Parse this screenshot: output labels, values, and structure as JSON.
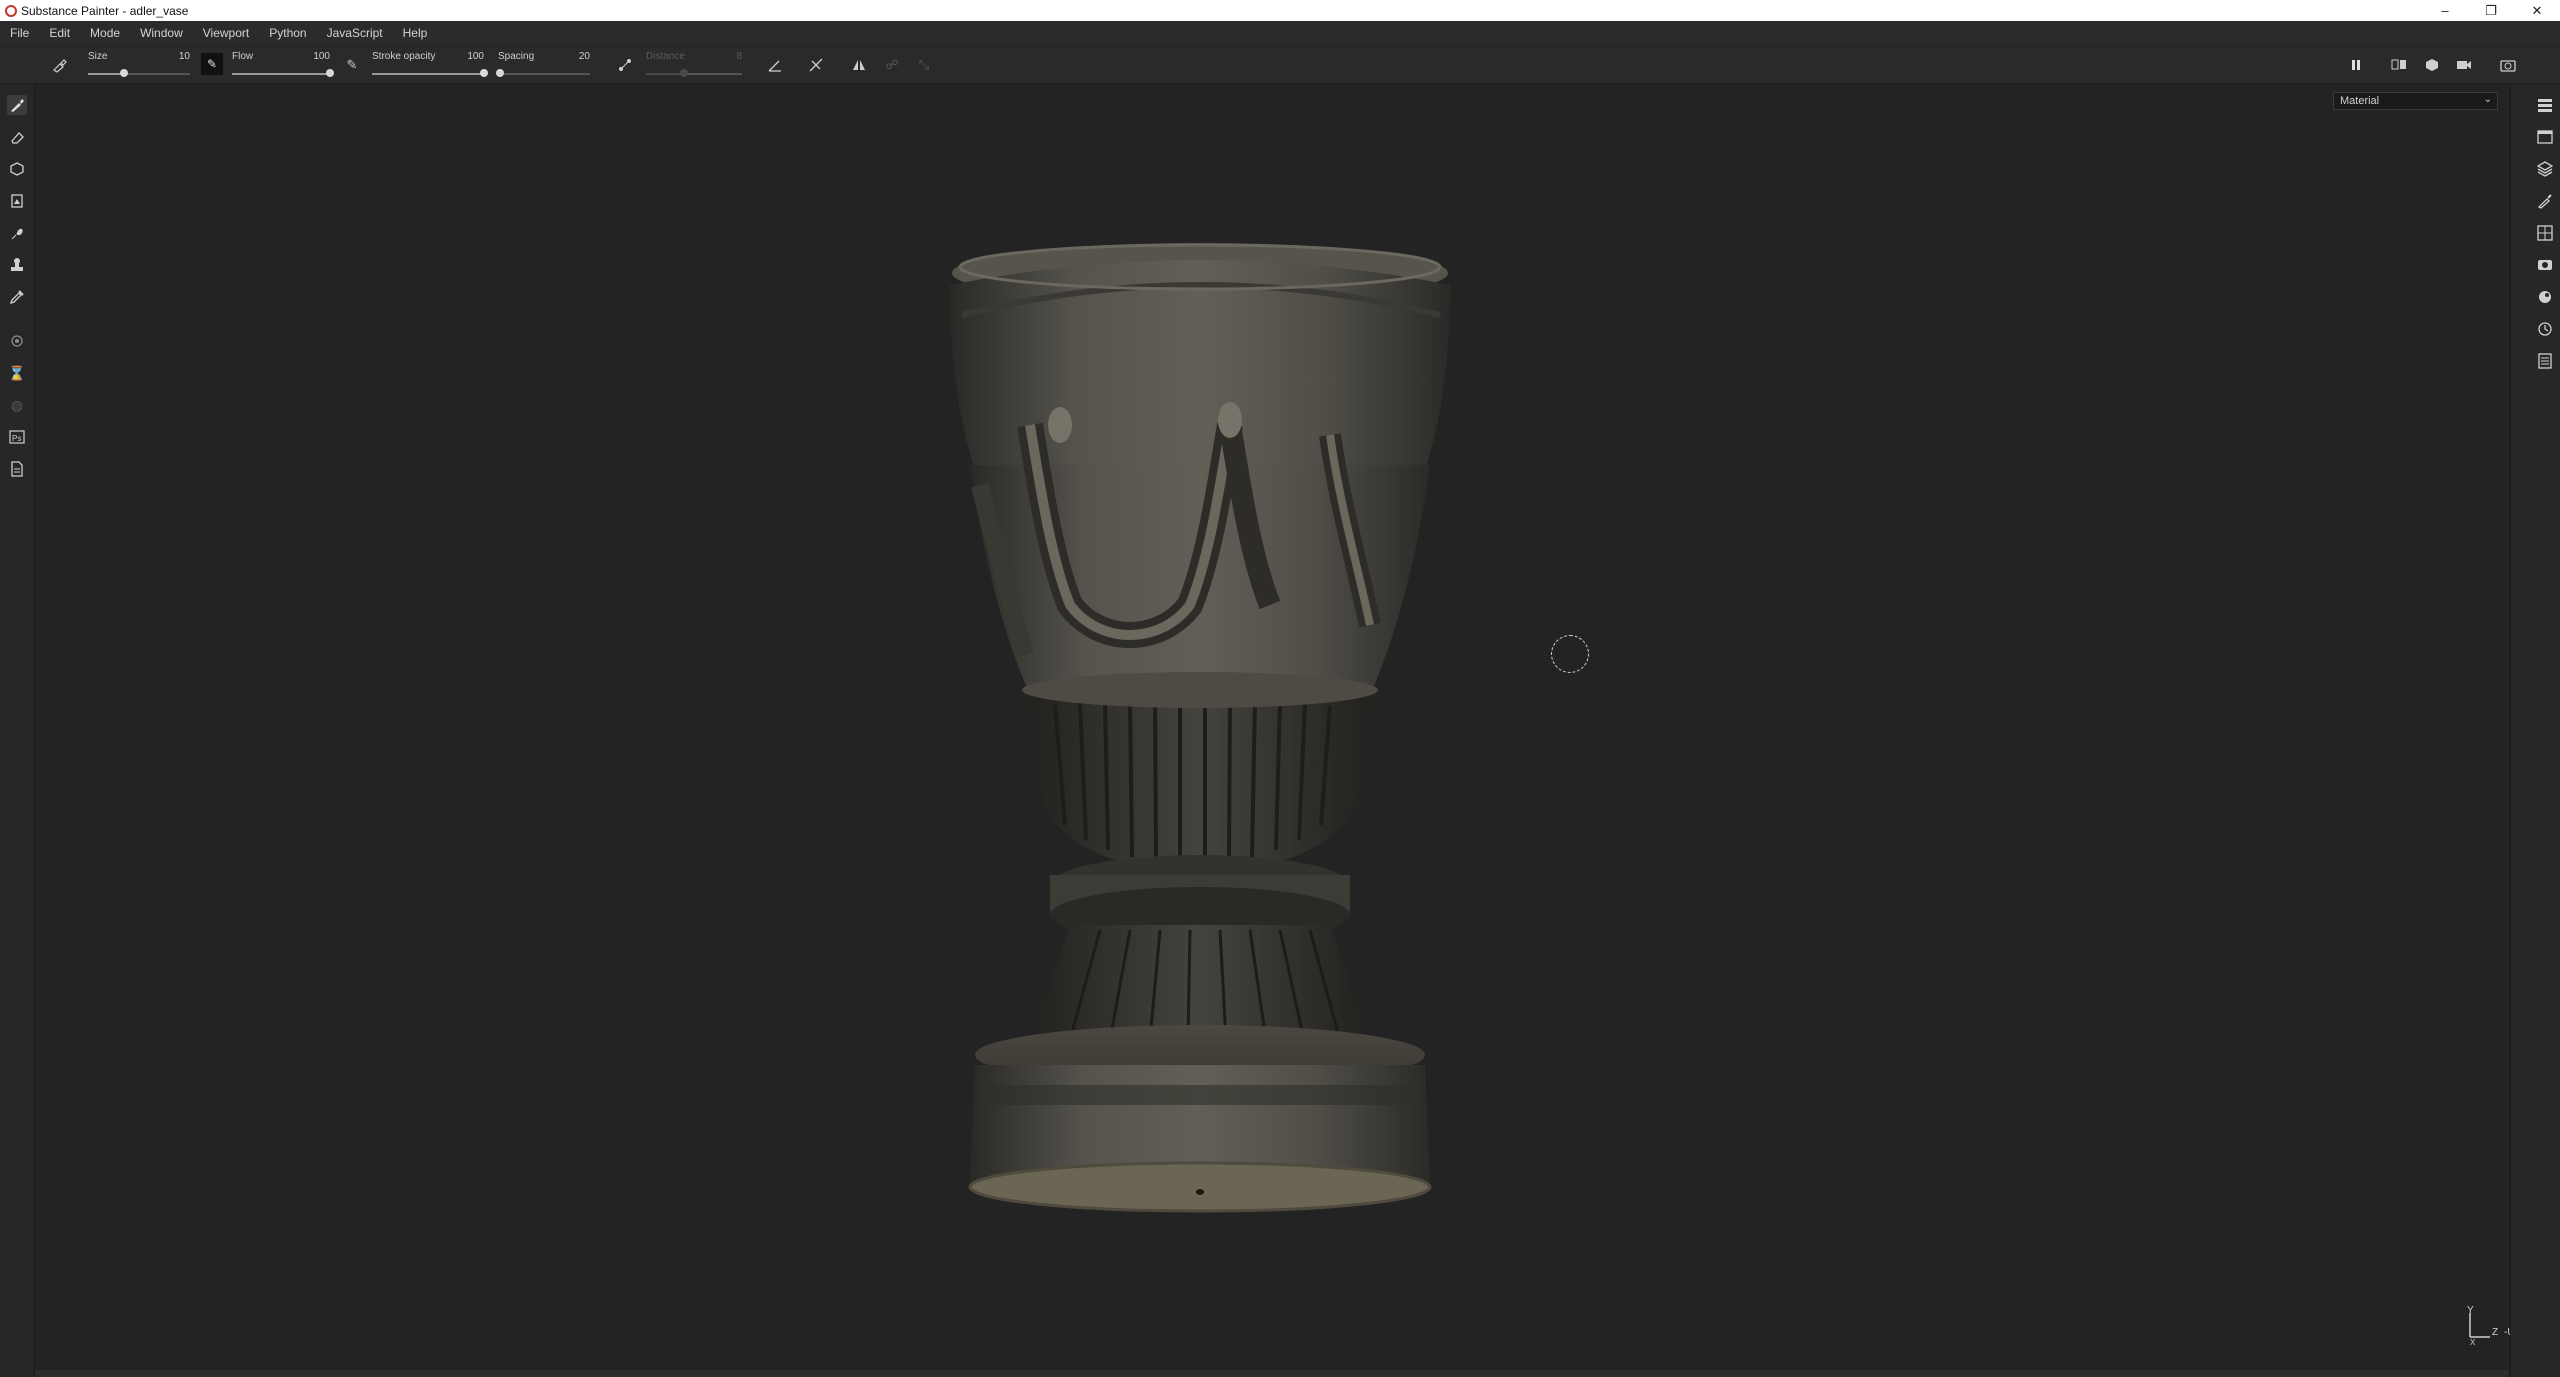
{
  "window": {
    "title": "Substance Painter - adler_vase",
    "controls": {
      "minimize": "–",
      "restore": "❐",
      "close": "✕"
    }
  },
  "menu": [
    "File",
    "Edit",
    "Mode",
    "Window",
    "Viewport",
    "Python",
    "JavaScript",
    "Help"
  ],
  "toolbar": {
    "size": {
      "label": "Size",
      "value": "10",
      "level": 0.35
    },
    "flow": {
      "label": "Flow",
      "value": "100",
      "level": 1.0
    },
    "stroke_opacity": {
      "label": "Stroke opacity",
      "value": "100",
      "level": 1.0
    },
    "spacing": {
      "label": "Spacing",
      "value": "20",
      "level": 0.02
    },
    "distance": {
      "label": "Distance",
      "value": "8",
      "level": 0.4,
      "disabled": true
    }
  },
  "left_tools": [
    {
      "name": "paint-brush-icon",
      "active": true
    },
    {
      "name": "eraser-icon"
    },
    {
      "name": "projection-icon"
    },
    {
      "name": "geometry-mask-icon"
    },
    {
      "name": "smudge-icon"
    },
    {
      "name": "clone-stamp-icon"
    },
    {
      "name": "color-picker-icon"
    },
    {
      "name": "bake-icon",
      "dim": true
    },
    {
      "name": "measure-icon",
      "dim": true
    },
    {
      "name": "polygon-fill-icon",
      "dim": true
    },
    {
      "name": "photoshop-export-icon"
    },
    {
      "name": "document-icon"
    }
  ],
  "right_panels": [
    "layers-panel-icon",
    "texture-set-list-icon",
    "texture-set-settings-icon",
    "brush-settings-icon",
    "display-settings-icon",
    "viewer-settings-icon",
    "shelf-icon",
    "history-icon",
    "log-icon"
  ],
  "viewport": {
    "channel": "Material",
    "axis": {
      "y": "Y",
      "z": "Z",
      "x": "X",
      "u": "-U"
    }
  },
  "colors": {
    "background": "#232323",
    "accent_green": "#2f5a3a",
    "close_red": "#c0392b"
  }
}
